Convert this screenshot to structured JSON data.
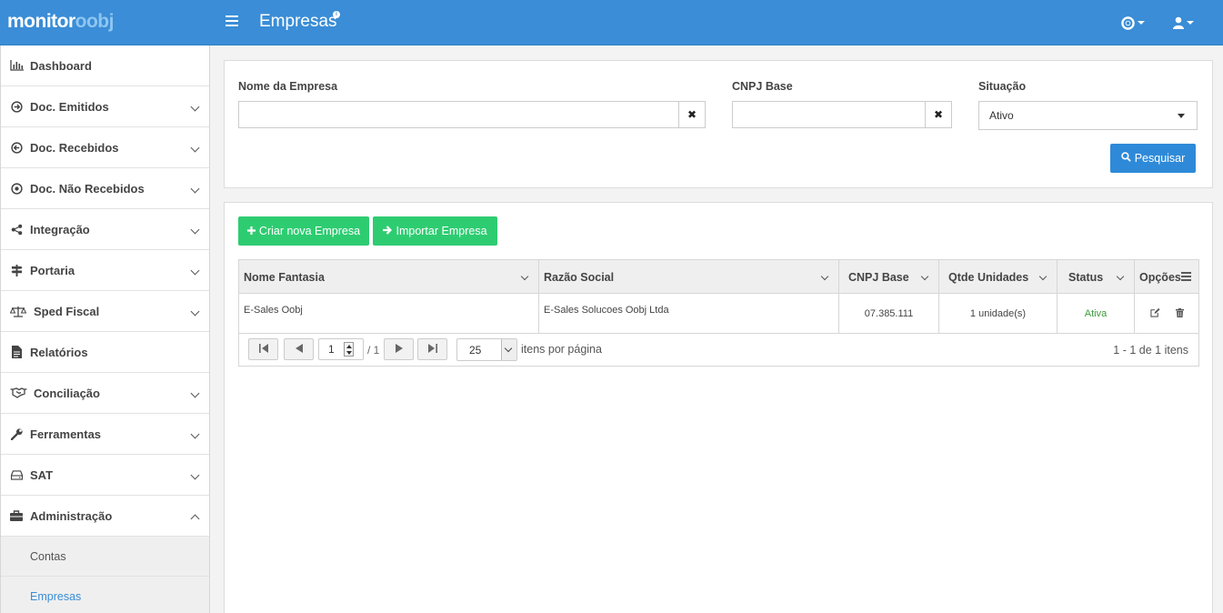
{
  "app": {
    "logo_bold": "monitor",
    "logo_light": "oobj",
    "page_title": "Empresas",
    "title_badge": "i"
  },
  "sidebar": {
    "items": [
      {
        "label": "Dashboard",
        "icon": "bar-chart-icon"
      },
      {
        "label": "Doc. Emitidos",
        "icon": "arrow-circle-right-icon"
      },
      {
        "label": "Doc. Recebidos",
        "icon": "arrow-circle-left-icon"
      },
      {
        "label": "Doc. Não Recebidos",
        "icon": "dot-circle-icon"
      },
      {
        "label": "Integração",
        "icon": "share-icon"
      },
      {
        "label": "Portaria",
        "icon": "signpost-icon"
      },
      {
        "label": "Sped Fiscal",
        "icon": "balance-scale-icon"
      },
      {
        "label": "Relatórios",
        "icon": "file-text-icon"
      },
      {
        "label": "Conciliação",
        "icon": "handshake-icon"
      },
      {
        "label": "Ferramentas",
        "icon": "wrench-icon"
      },
      {
        "label": "SAT",
        "icon": "hdd-icon"
      },
      {
        "label": "Administração",
        "icon": "briefcase-icon"
      }
    ],
    "sub_items": [
      {
        "label": "Contas"
      },
      {
        "label": "Empresas"
      }
    ]
  },
  "filters": {
    "company_name_label": "Nome da Empresa",
    "company_name_value": "",
    "cnpj_label": "CNPJ Base",
    "cnpj_value": "",
    "status_label": "Situação",
    "status_value": "Ativo",
    "search_button": "Pesquisar"
  },
  "actions": {
    "create_button": "Criar nova Empresa",
    "import_button": "Importar Empresa"
  },
  "table": {
    "columns": [
      "Nome Fantasia",
      "Razão Social",
      "CNPJ Base",
      "Qtde Unidades",
      "Status",
      "Opções"
    ],
    "rows": [
      {
        "nome_fantasia": "E-Sales Oobj",
        "razao_social": "E-Sales Solucoes Oobj Ltda",
        "cnpj_base": "07.385.111",
        "qtde_unidades": "1 unidade(s)",
        "status": "Ativa"
      }
    ]
  },
  "pager": {
    "current_page": "1",
    "total_pages": "/ 1",
    "page_size": "25",
    "page_size_label": "itens por página",
    "range_label": "1 - 1 de 1 itens"
  },
  "colors": {
    "topbar": "#3a8dd6",
    "primary_button": "#2e8ad8",
    "success_button": "#2ecc71",
    "status_active": "#3c9a3c"
  }
}
